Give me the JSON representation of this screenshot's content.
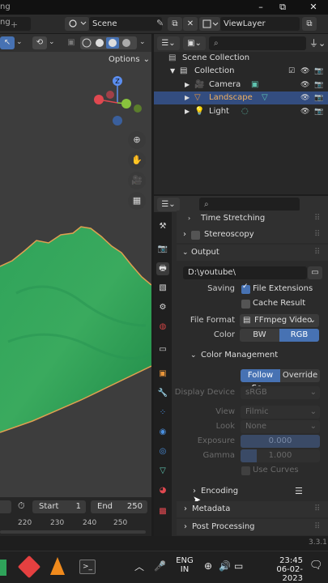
{
  "window": {
    "title_fragment": "ng",
    "minimize": "–",
    "maximize": "⧉",
    "close": "✕"
  },
  "topbar": {
    "scene_label": "Scene",
    "viewlayer_label": "ViewLayer"
  },
  "viewport": {
    "options_label": "Options",
    "gizmo_axes": [
      "Z",
      "X",
      "Y"
    ]
  },
  "outliner": {
    "search_placeholder": "",
    "items": [
      {
        "label": "Scene Collection"
      },
      {
        "label": "Collection"
      },
      {
        "label": "Camera"
      },
      {
        "label": "Landscape"
      },
      {
        "label": "Light"
      }
    ]
  },
  "properties": {
    "search_placeholder": "",
    "time_stretching": "Time Stretching",
    "stereoscopy": "Stereoscopy",
    "output_title": "Output",
    "output_path": "D:\\youtube\\",
    "saving_label": "Saving",
    "file_extensions": "File Extensions",
    "cache_result": "Cache Result",
    "file_format_label": "File Format",
    "file_format_value": "FFmpeg Video",
    "color_label": "Color",
    "color_bw": "BW",
    "color_rgb": "RGB",
    "color_management": "Color Management",
    "follow_scene": "Follow Sc...",
    "override": "Override",
    "display_device_label": "Display Device",
    "display_device_value": "sRGB",
    "view_label": "View",
    "view_value": "Filmic",
    "look_label": "Look",
    "look_value": "None",
    "exposure_label": "Exposure",
    "exposure_value": "0.000",
    "gamma_label": "Gamma",
    "gamma_value": "1.000",
    "use_curves": "Use Curves",
    "encoding": "Encoding",
    "metadata": "Metadata",
    "post_processing": "Post Processing"
  },
  "timeline": {
    "start_label": "Start",
    "start_value": "1",
    "end_label": "End",
    "end_value": "250",
    "ticks": [
      "220",
      "230",
      "240",
      "250"
    ]
  },
  "status": {
    "version": "3.3.1"
  },
  "taskbar": {
    "lang_top": "ENG",
    "lang_bottom": "IN",
    "time": "23:45",
    "date": "06-02-2023"
  }
}
